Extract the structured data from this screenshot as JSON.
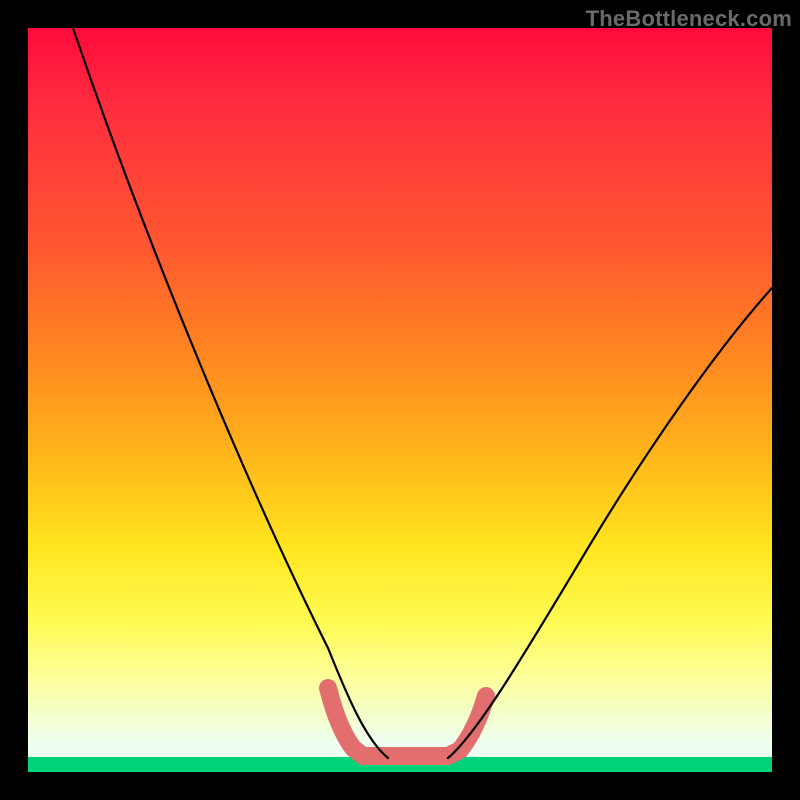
{
  "watermark": "TheBottleneck.com",
  "colors": {
    "background": "#000000",
    "gradient_top": "#ff0a3a",
    "gradient_mid1": "#ff8a20",
    "gradient_mid2": "#ffe61f",
    "gradient_bottom": "#eefff0",
    "green_strip": "#00d27a",
    "curve": "#000000",
    "highlight": "#e36e6e"
  },
  "chart_data": {
    "type": "line",
    "title": "",
    "xlabel": "",
    "ylabel": "",
    "xlim": [
      0,
      100
    ],
    "ylim": [
      0,
      100
    ],
    "x": [
      6,
      10,
      15,
      20,
      25,
      30,
      35,
      40,
      42,
      45,
      48,
      50,
      52,
      55,
      58,
      60,
      65,
      70,
      75,
      80,
      85,
      90,
      95,
      100
    ],
    "values": [
      100,
      90,
      78,
      66,
      55,
      44,
      34,
      20,
      12,
      6,
      3,
      2,
      2,
      3,
      5,
      9,
      17,
      26,
      35,
      43,
      50,
      56,
      61,
      65
    ],
    "highlight_region_x": [
      40,
      60
    ],
    "note": "V-shaped bottleneck curve; y is bottleneck percent (higher = worse), minimum ≈2% around x≈50–52; background gradient encodes y (red high, green low); pink thick segment marks the sweet-spot region near the minimum."
  }
}
